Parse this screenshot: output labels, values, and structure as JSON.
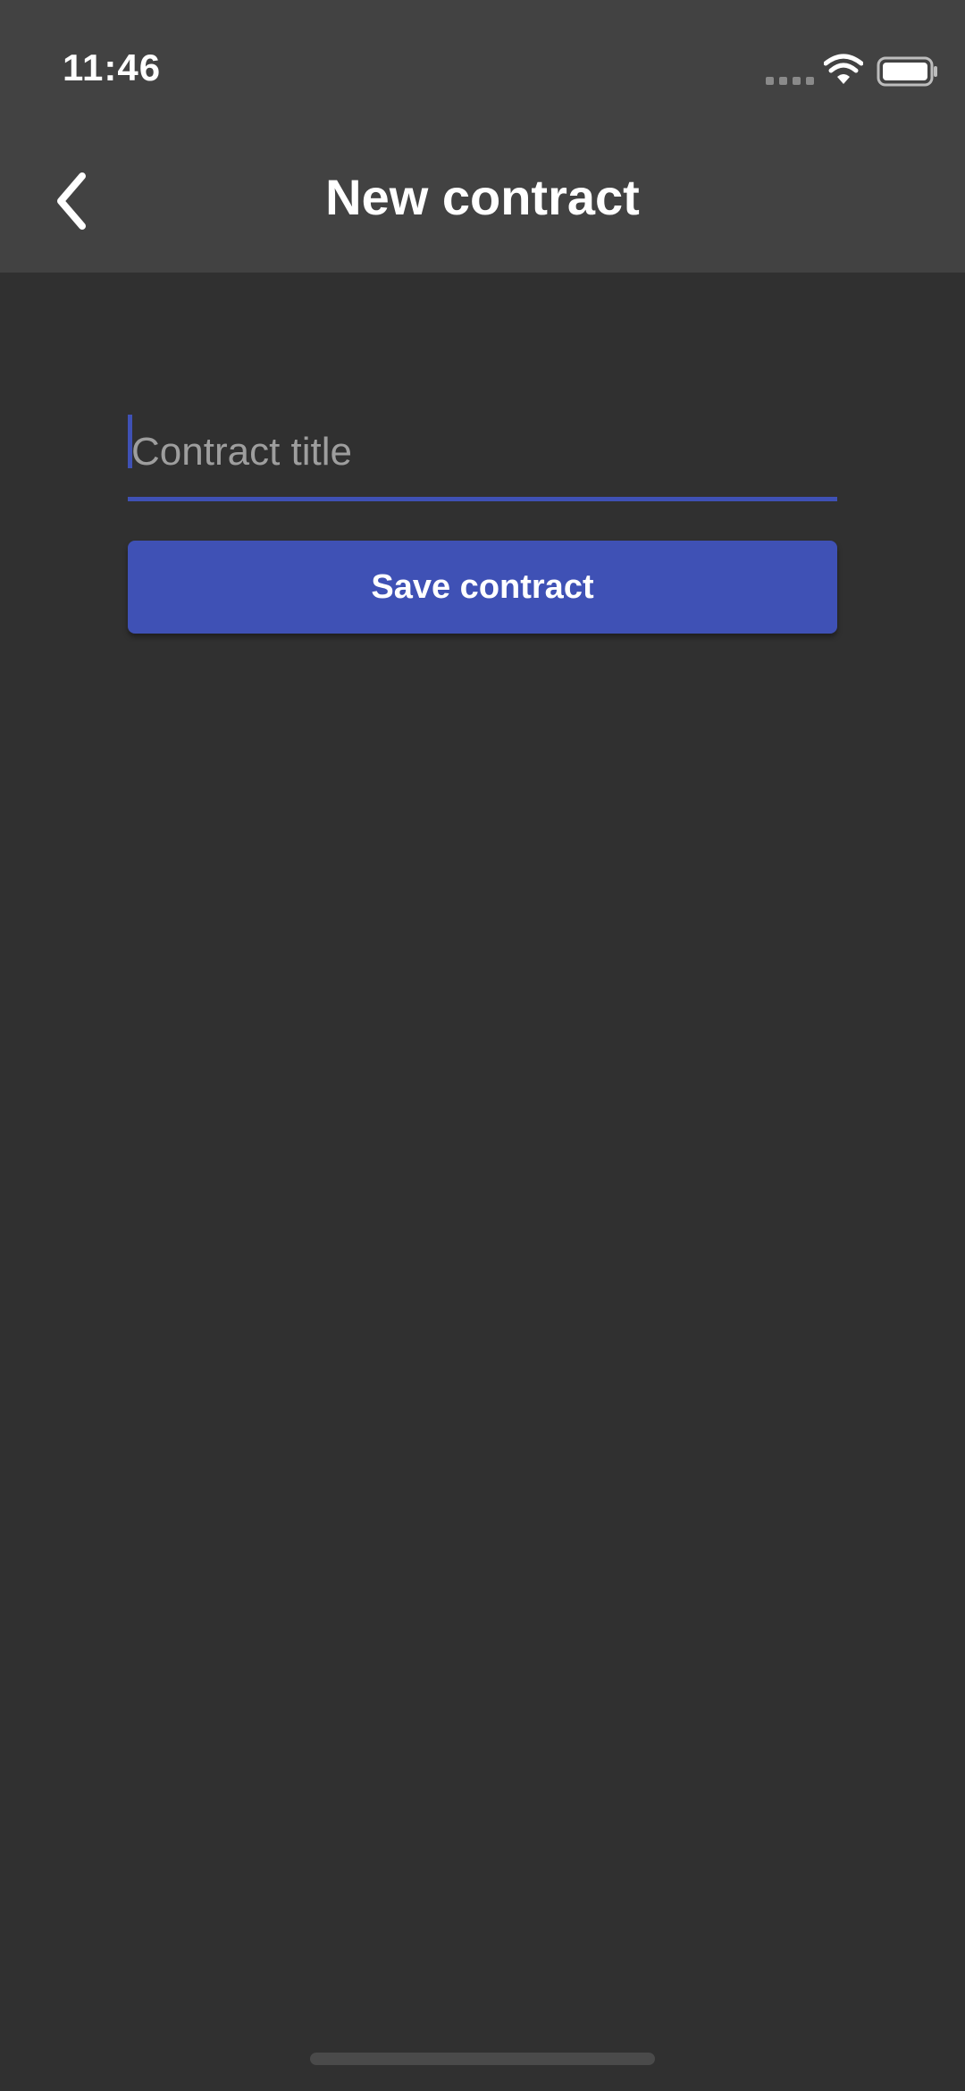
{
  "status_bar": {
    "time": "11:46",
    "icons": [
      "signal-dots-icon",
      "wifi-icon",
      "battery-icon"
    ]
  },
  "header": {
    "title": "New contract",
    "back_icon": "chevron-left-icon"
  },
  "form": {
    "title_input": {
      "value": "",
      "placeholder": "Contract title"
    },
    "save_label": "Save contract"
  },
  "colors": {
    "background": "#303030",
    "app_bar": "#424242",
    "accent": "#3f51b5",
    "text": "#ffffff",
    "placeholder": "#9e9e9e"
  }
}
